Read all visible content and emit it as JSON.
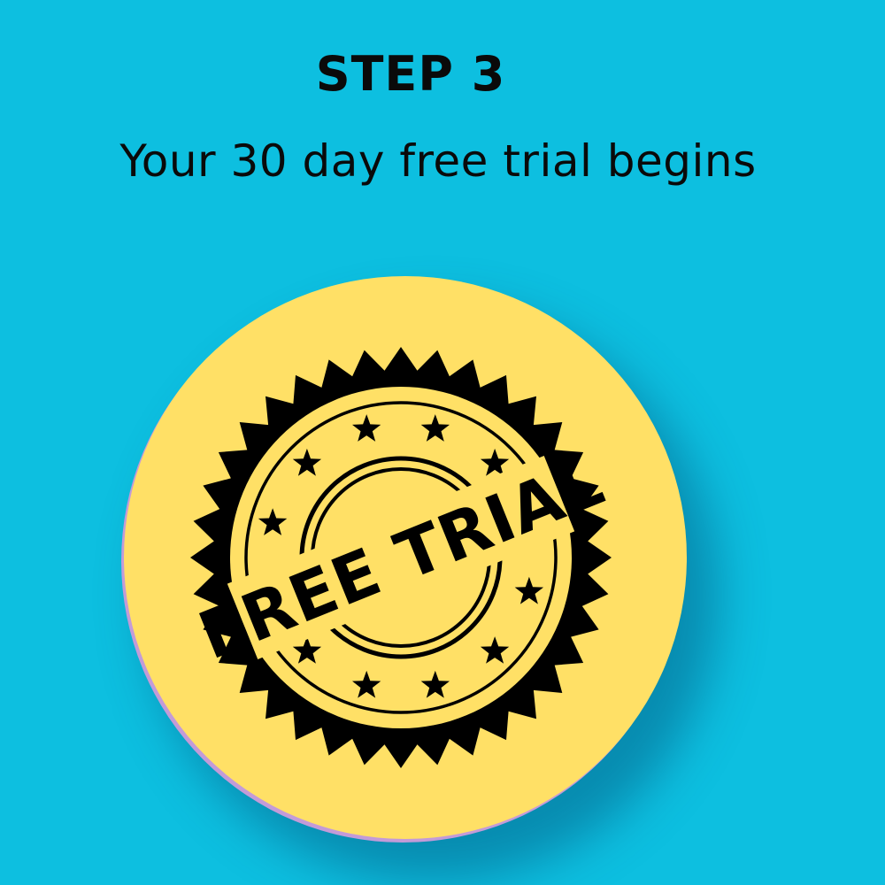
{
  "step": {
    "title": "STEP 3",
    "subtitle": "Your 30 day free trial begins"
  },
  "badge": {
    "label": "FREE TRIAL",
    "icon": "free-trial-seal-icon"
  },
  "colors": {
    "background": "#0dbfe0",
    "circle": "#ffe066",
    "ink": "#000000"
  }
}
